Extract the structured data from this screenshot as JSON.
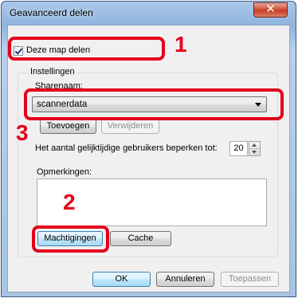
{
  "window": {
    "title": "Geavanceerd delen",
    "close_glyph": "✕"
  },
  "share_checkbox": {
    "label": "Deze map delen",
    "checked": true
  },
  "settings": {
    "group_label": "Instellingen",
    "share_name_label": "Sharenaam:",
    "share_name_value": "scannerdata",
    "add_button": "Toevoegen",
    "remove_button": "Verwijderen",
    "limit_label": "Het aantal gelijktijdige gebruikers beperken tot:",
    "limit_value": "20",
    "comments_label": "Opmerkingen:",
    "comments_value": "",
    "permissions_button": "Machtigingen",
    "cache_button": "Cache"
  },
  "footer": {
    "ok_button": "OK",
    "cancel_button": "Annuleren",
    "apply_button": "Toepassen"
  },
  "callouts": {
    "step1": "1",
    "step2": "2",
    "step3": "3",
    "color": "#e4001a"
  },
  "icons": [
    "close-icon",
    "checkmark-icon",
    "dropdown-arrow-icon",
    "spin-up-icon",
    "spin-down-icon"
  ]
}
